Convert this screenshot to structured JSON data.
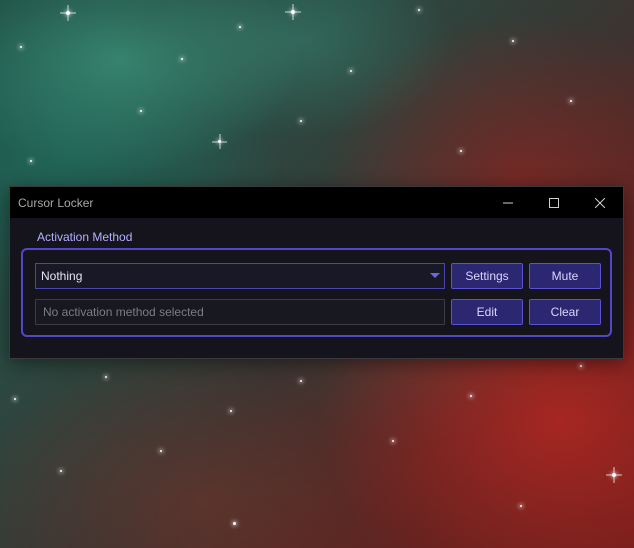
{
  "window": {
    "title": "Cursor Locker",
    "controls": {
      "minimize_icon": "minimize-icon",
      "maximize_icon": "maximize-icon",
      "close_icon": "close-icon"
    }
  },
  "activation": {
    "group_label": "Activation Method",
    "method_select": {
      "selected": "Nothing"
    },
    "status_field": {
      "placeholder": "No activation method selected",
      "value": ""
    },
    "buttons": {
      "settings": "Settings",
      "mute": "Mute",
      "edit": "Edit",
      "clear": "Clear"
    }
  },
  "colors": {
    "accent": "#5148c8",
    "button_fill": "#2b2770",
    "label_text": "#b4b0ff",
    "window_bg": "#15141d",
    "titlebar_bg": "#000000"
  }
}
